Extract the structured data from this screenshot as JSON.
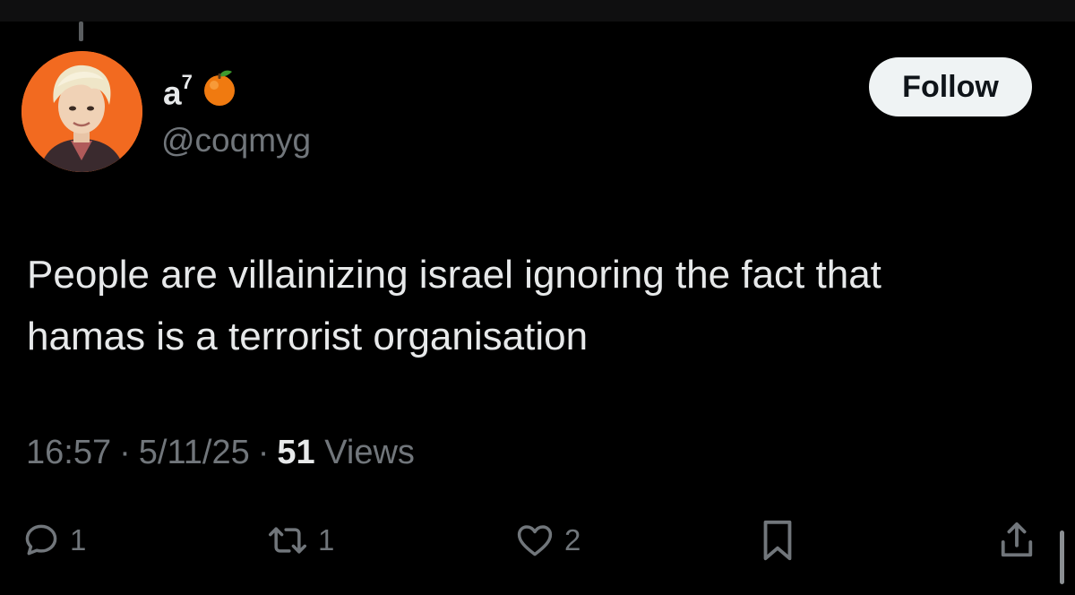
{
  "tweet": {
    "display_name": "a",
    "display_name_sup": "7",
    "name_emoji": "orange-emoji",
    "handle": "@coqmyg",
    "follow_label": "Follow",
    "text_line1": "People are villainizing israel ignoring the fact that",
    "text_line2": "hamas is a terrorist organisation",
    "time": "16:57",
    "date": "5/11/25",
    "separator": "·",
    "views_count": "51",
    "views_label": "Views"
  },
  "actions": {
    "replies": "1",
    "retweets": "1",
    "likes": "2"
  },
  "icons": {
    "reply": "speech-bubble-icon",
    "retweet": "retweet-icon",
    "like": "heart-icon",
    "bookmark": "bookmark-icon",
    "share": "share-icon"
  },
  "colors": {
    "background": "#000000",
    "text": "#e7e9ea",
    "muted": "#71767b",
    "follow_bg": "#eff3f4",
    "avatar_bg": "#f26a20"
  }
}
